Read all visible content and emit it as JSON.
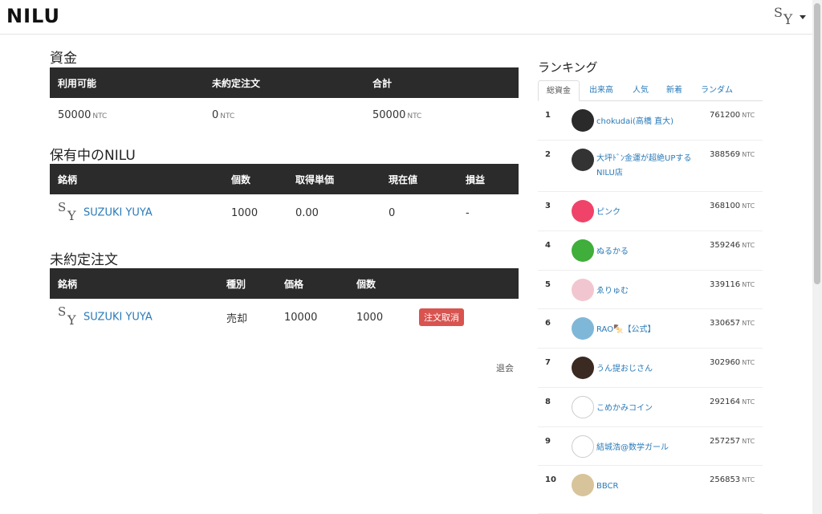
{
  "navbar": {
    "brand": "NILU",
    "user_initial_s": "S",
    "user_initial_y": "Y"
  },
  "funds": {
    "title": "資金",
    "headers": [
      "利用可能",
      "未約定注文",
      "合計"
    ],
    "values": [
      "50000",
      "0",
      "50000"
    ],
    "unit": "NTC"
  },
  "holdings": {
    "title": "保有中のNILU",
    "headers": [
      "銘柄",
      "個数",
      "取得単価",
      "現在値",
      "損益"
    ],
    "row": {
      "logo_s": "S",
      "logo_y": "Y",
      "name": "SUZUKI YUYA",
      "count": "1000",
      "unit_price": "0.00",
      "current": "0",
      "pnl": "-"
    }
  },
  "orders": {
    "title": "未約定注文",
    "headers": [
      "銘柄",
      "種別",
      "価格",
      "個数",
      ""
    ],
    "row": {
      "logo_s": "S",
      "logo_y": "Y",
      "name": "SUZUKI YUYA",
      "type": "売却",
      "price": "10000",
      "count": "1000",
      "cancel_label": "注文取消"
    }
  },
  "withdraw_label": "退会",
  "ranking": {
    "title": "ランキング",
    "tabs": [
      "総資金",
      "出来高",
      "人気",
      "新着",
      "ランダム"
    ],
    "unit": "NTC",
    "items": [
      {
        "rank": "1",
        "name": "chokudai(高橋 直大)",
        "value": "761200",
        "avatar_color": "#2a2a2a"
      },
      {
        "rank": "2",
        "name": "大坪ﾄﾞﾝ金運が超絶UPするNILU店",
        "value": "388569",
        "avatar_color": "#333333"
      },
      {
        "rank": "3",
        "name": "ピンク",
        "value": "368100",
        "avatar_color": "#f0436a"
      },
      {
        "rank": "4",
        "name": "ぬるかる",
        "value": "359246",
        "avatar_color": "#3fae3a"
      },
      {
        "rank": "5",
        "name": "ゑりゅむ",
        "value": "339116",
        "avatar_color": "#f2c6d0"
      },
      {
        "rank": "6",
        "name": "RAO🍢【公式】",
        "value": "330657",
        "avatar_color": "#7fb7d8"
      },
      {
        "rank": "7",
        "name": "うん提おじさん",
        "value": "302960",
        "avatar_color": "#3a2a22"
      },
      {
        "rank": "8",
        "name": "こめかみコイン",
        "value": "292164",
        "avatar_color": "#ffffff"
      },
      {
        "rank": "9",
        "name": "結城浩@数学ガール",
        "value": "257257",
        "avatar_color": "#ffffff"
      },
      {
        "rank": "10",
        "name": "BBCR",
        "value": "256853",
        "avatar_color": "#d8c49a"
      }
    ]
  }
}
